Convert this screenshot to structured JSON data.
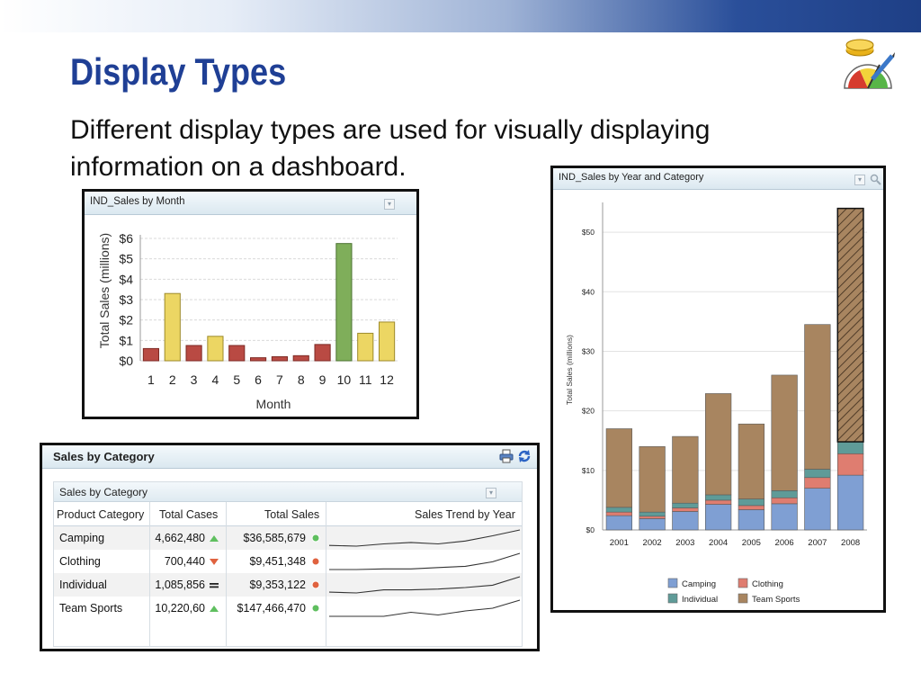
{
  "slide": {
    "title": "Display Types",
    "body": "Different display types are used for visually displaying information on a dashboard."
  },
  "logo": {
    "icon": "coins-gauge-pencil-icon"
  },
  "colors": {
    "title": "#1f3f95",
    "bar_red": "#b94a43",
    "bar_yellow": "#ecd663",
    "bar_green": "#7fae5a",
    "camping": "#7f9fd3",
    "clothing": "#df7d70",
    "individual": "#5f9b98",
    "team_sports": "#a88560",
    "status_up": "#5fbf5f",
    "status_down": "#e0623f"
  },
  "monthly_panel": {
    "title": "IND_Sales by Month",
    "menu_icon": "dropdown-menu-icon"
  },
  "category_panel": {
    "title": "Sales by Category",
    "toolbar_icons": [
      "print-icon",
      "refresh-icon"
    ],
    "table": {
      "title": "Sales by Category",
      "menu_icon": "dropdown-menu-icon",
      "columns": [
        "Product Category",
        "Total Cases",
        "Total Sales",
        "Sales Trend by Year"
      ],
      "rows": [
        {
          "category": "Camping",
          "cases": "4,662,480",
          "cases_trend": "up",
          "sales": "$36,585,679",
          "sales_status": "good",
          "trend": [
            1.2,
            1.1,
            1.4,
            1.6,
            1.4,
            1.8,
            2.5,
            3.3
          ]
        },
        {
          "category": "Clothing",
          "cases": "700,440",
          "cases_trend": "down",
          "sales": "$9,451,348",
          "sales_status": "bad",
          "trend": [
            1.0,
            1.0,
            1.1,
            1.1,
            1.3,
            1.5,
            2.2,
            3.5
          ]
        },
        {
          "category": "Individual",
          "cases": "1,085,856",
          "cases_trend": "flat",
          "sales": "$9,353,122",
          "sales_status": "bad",
          "trend": [
            1.1,
            1.0,
            1.4,
            1.4,
            1.5,
            1.7,
            2.0,
            3.1
          ]
        },
        {
          "category": "Team Sports",
          "cases": "10,220,60",
          "cases_trend": "up",
          "sales": "$147,466,470",
          "sales_status": "good",
          "trend": [
            1.0,
            1.0,
            1.0,
            1.6,
            1.2,
            1.8,
            2.2,
            3.4
          ]
        }
      ]
    }
  },
  "yearly_panel": {
    "title": "IND_Sales by Year and Category",
    "toolbar_icons": [
      "dropdown-menu-icon",
      "zoom-icon"
    ]
  },
  "chart_data": [
    {
      "type": "bar",
      "xlabel": "Month",
      "ylabel": "Total Sales (millions)",
      "categories": [
        "1",
        "2",
        "3",
        "4",
        "5",
        "6",
        "7",
        "8",
        "9",
        "10",
        "11",
        "12"
      ],
      "values": [
        0.6,
        3.3,
        0.75,
        1.2,
        0.75,
        0.15,
        0.2,
        0.25,
        0.8,
        5.75,
        1.35,
        1.9
      ],
      "colors": [
        "red",
        "yellow",
        "red",
        "yellow",
        "red",
        "red",
        "red",
        "red",
        "red",
        "green",
        "yellow",
        "yellow"
      ],
      "yticks": [
        "$0",
        "$1",
        "$2",
        "$3",
        "$4",
        "$5",
        "$6"
      ],
      "ylim": [
        0,
        6
      ],
      "grid": true
    },
    {
      "type": "bar",
      "stacked": true,
      "ylabel": "Total Sales (millions)",
      "categories": [
        "2001",
        "2002",
        "2003",
        "2004",
        "2005",
        "2006",
        "2007",
        "2008"
      ],
      "series": [
        {
          "name": "Camping",
          "values": [
            2.4,
            1.9,
            3.1,
            4.3,
            3.4,
            4.4,
            7.0,
            9.2
          ]
        },
        {
          "name": "Clothing",
          "values": [
            0.6,
            0.4,
            0.6,
            0.7,
            0.7,
            1.0,
            1.8,
            3.6
          ]
        },
        {
          "name": "Individual",
          "values": [
            0.8,
            0.7,
            0.8,
            0.9,
            1.1,
            1.2,
            1.4,
            2.0
          ]
        },
        {
          "name": "Team Sports",
          "values": [
            13.2,
            11.0,
            11.2,
            17.0,
            12.6,
            19.4,
            24.3,
            39.2
          ]
        }
      ],
      "highlighted": "2008",
      "yticks": [
        "$0",
        "$10",
        "$20",
        "$30",
        "$40",
        "$50"
      ],
      "ylim": [
        0,
        55
      ],
      "legend_position": "bottom",
      "grid": true
    }
  ]
}
